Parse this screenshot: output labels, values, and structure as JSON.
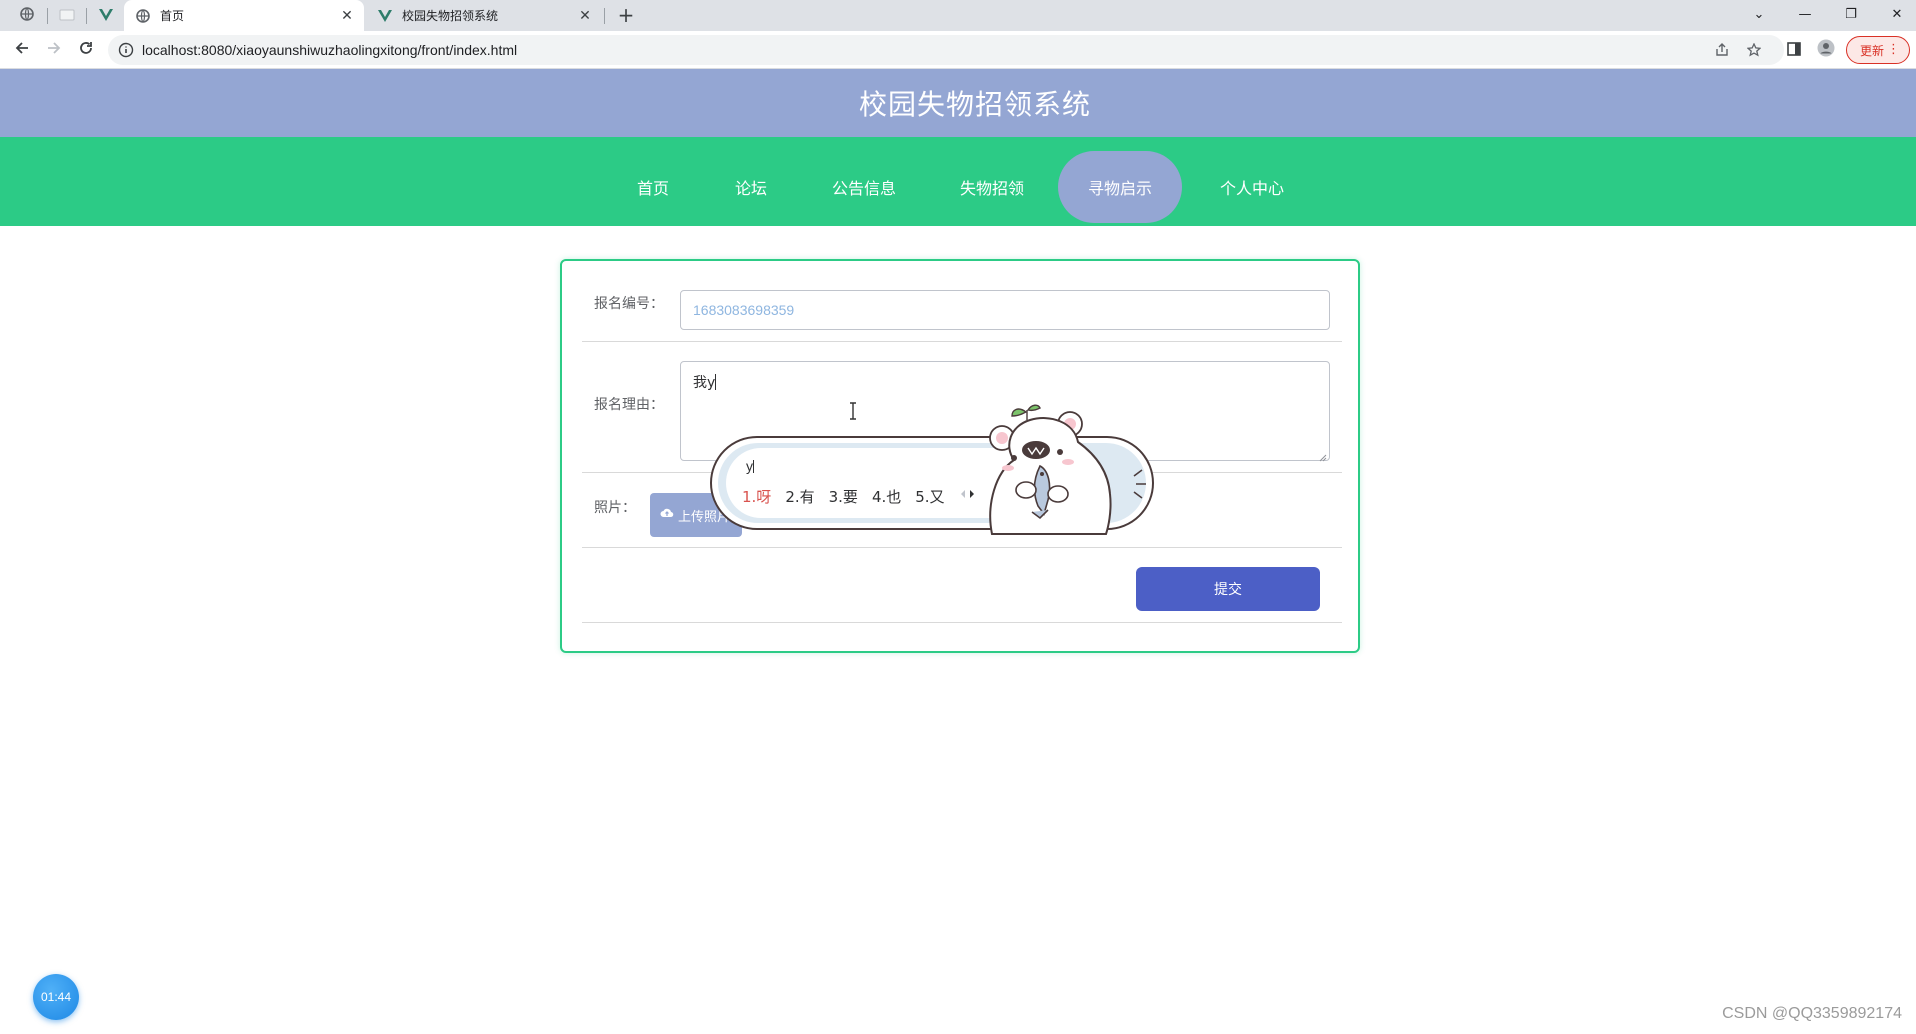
{
  "browser": {
    "tabs": [
      {
        "title": "首页",
        "active": true
      },
      {
        "title": "校园失物招领系统",
        "active": false
      }
    ],
    "close_glyph": "✕",
    "new_tab_glyph": "+",
    "window_controls": [
      "⌄",
      "—",
      "❐",
      "✕"
    ],
    "url": "localhost:8080/xiaoyaunshiwuzhaolingxitong/front/index.html",
    "update_label": "更新",
    "menu_glyph": "⋮"
  },
  "site": {
    "title": "校园失物招领系统",
    "nav": [
      "首页",
      "论坛",
      "公告信息",
      "失物招领",
      "寻物启示",
      "个人中心"
    ],
    "active_nav": "寻物启示"
  },
  "form": {
    "number_label": "报名编号：",
    "number_value": "1683083698359",
    "reason_label": "报名理由：",
    "reason_value": "我y",
    "photo_label": "照片：",
    "upload_label": "上传照片",
    "submit_label": "提交"
  },
  "ime": {
    "composition": "y",
    "candidates": [
      "1.呀",
      "2.有",
      "3.要",
      "4.也",
      "5.又"
    ]
  },
  "timer": "01:44",
  "watermark": "CSDN @QQ3359892174",
  "colors": {
    "header": "#94a6d3",
    "nav": "#2ccb86",
    "submit": "#4c5fc6",
    "accent_active": "#94a6d3"
  }
}
